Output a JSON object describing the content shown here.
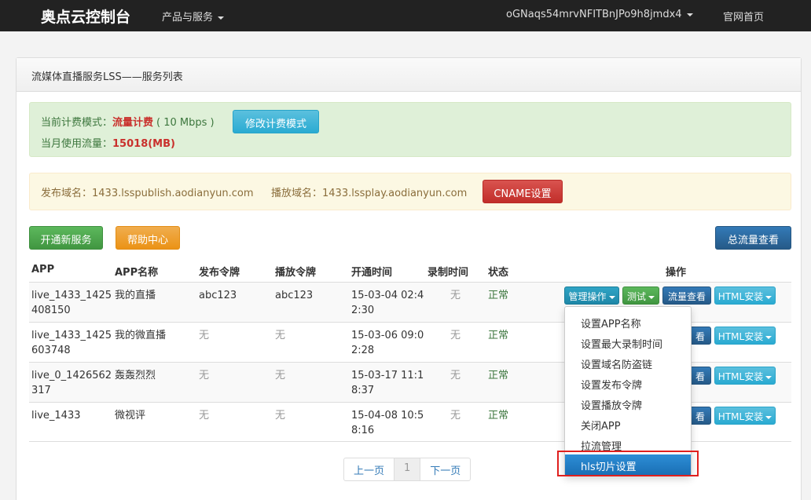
{
  "navbar": {
    "brand": "奥点云控制台",
    "products_label": "产品与服务",
    "user_label": "oGNaqs54mrvNFITBnJPo9h8jmdx4",
    "home_label": "官网首页"
  },
  "panel": {
    "title": "流媒体直播服务LSS——服务列表"
  },
  "billing": {
    "mode_label": "当前计费模式：",
    "mode_value": "流量计费",
    "bandwidth": "( 10 Mbps )",
    "change_button": "修改计费模式",
    "usage_label": "当月使用流量：",
    "usage_value": "15018(MB)"
  },
  "domains": {
    "publish": "发布域名：1433.lsspublish.aodianyun.com",
    "play": "播放域名：1433.lssplay.aodianyun.com",
    "cname_button": "CNAME设置"
  },
  "actions": {
    "new_service": "开通新服务",
    "help_center": "帮助中心",
    "total_traffic": "总流量查看"
  },
  "table": {
    "headers": [
      "APP",
      "APP名称",
      "发布令牌",
      "播放令牌",
      "开通时间",
      "录制时间",
      "状态",
      "操作"
    ],
    "rows": [
      {
        "app_l1": "live_1433_1425",
        "app_l2": "408150",
        "name": "我的直播",
        "pub": "abc123",
        "play": "abc123",
        "time_l1": "15-03-04 02:4",
        "time_l2": "2:30",
        "rec": "无",
        "status": "正常"
      },
      {
        "app_l1": "live_1433_1425",
        "app_l2": "603748",
        "name": "我的微直播",
        "pub": "无",
        "play": "无",
        "time_l1": "15-03-06 09:0",
        "time_l2": "2:28",
        "rec": "无",
        "status": "正常"
      },
      {
        "app_l1": "live_0_1426562",
        "app_l2": "317",
        "name": "轰轰烈烈",
        "pub": "无",
        "play": "无",
        "time_l1": "15-03-17 11:1",
        "time_l2": "8:37",
        "rec": "无",
        "status": "正常"
      },
      {
        "app_l1": "live_1433",
        "app_l2": "",
        "name": "微视评",
        "pub": "无",
        "play": "无",
        "time_l1": "15-04-08 10:5",
        "time_l2": "8:16",
        "rec": "无",
        "status": "正常"
      }
    ],
    "op_manage": "管理操作",
    "op_test": "测试",
    "op_traffic": "流量查看",
    "op_traffic_partial": "看",
    "op_html": "HTML安装"
  },
  "dropdown": {
    "items": [
      "设置APP名称",
      "设置最大录制时间",
      "设置域名防盗链",
      "设置发布令牌",
      "设置播放令牌",
      "关闭APP",
      "拉流管理",
      "hls切片设置"
    ],
    "active_index": 7
  },
  "pagination": {
    "prev": "上一页",
    "current": "1",
    "next": "下一页"
  },
  "colors": {
    "navbar_bg": "#222222",
    "success_bg": "#dff0d8",
    "warning_bg": "#fcf8e3",
    "highlight_border": "#e0201e",
    "active_item_bg": "#1a6fb5"
  }
}
